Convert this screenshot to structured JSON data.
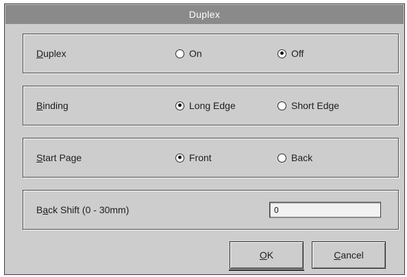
{
  "dialog": {
    "title": "Duplex"
  },
  "duplex": {
    "label_ul": "D",
    "label_rest": "uplex",
    "options": [
      {
        "label": "On",
        "checked": false
      },
      {
        "label": "Off",
        "checked": true
      }
    ]
  },
  "binding": {
    "label_ul": "B",
    "label_rest": "inding",
    "options": [
      {
        "label": "Long Edge",
        "checked": true
      },
      {
        "label": "Short Edge",
        "checked": false
      }
    ]
  },
  "start_page": {
    "label_ul": "S",
    "label_rest": "tart Page",
    "options": [
      {
        "label": "Front",
        "checked": true
      },
      {
        "label": "Back",
        "checked": false
      }
    ]
  },
  "back_shift": {
    "label_pre": "B",
    "label_ul": "a",
    "label_rest": "ck Shift (0 - 30mm)",
    "value": "0"
  },
  "buttons": {
    "ok_ul": "O",
    "ok_rest": "K",
    "cancel_ul": "C",
    "cancel_rest": "ancel"
  }
}
